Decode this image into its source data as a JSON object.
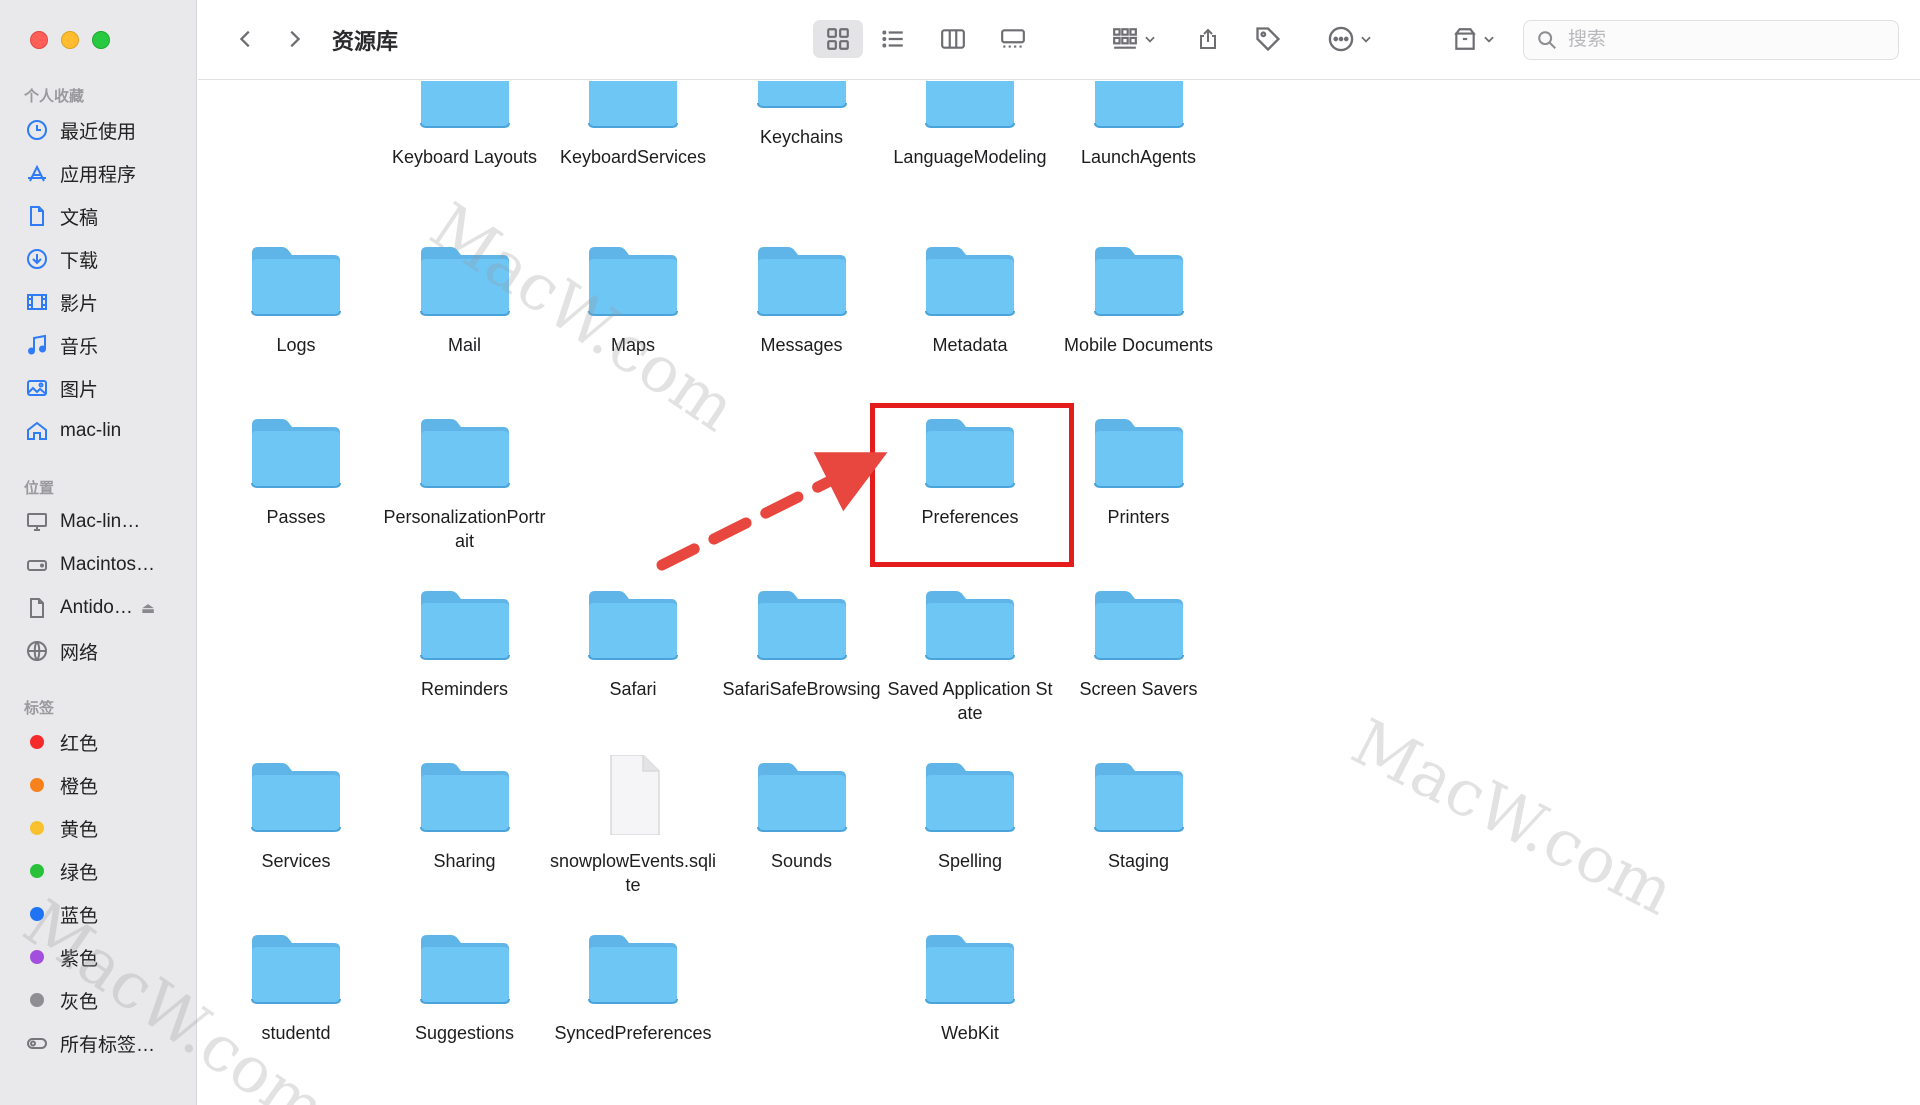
{
  "window": {
    "title": "资源库"
  },
  "sidebar": {
    "sections": {
      "favorites": "个人收藏",
      "locations": "位置",
      "tags": "标签"
    },
    "favorites": [
      {
        "label": "最近使用",
        "icon": "clock-icon"
      },
      {
        "label": "应用程序",
        "icon": "apps-icon"
      },
      {
        "label": "文稿",
        "icon": "document-icon"
      },
      {
        "label": "下载",
        "icon": "download-icon"
      },
      {
        "label": "影片",
        "icon": "film-icon"
      },
      {
        "label": "音乐",
        "icon": "music-icon"
      },
      {
        "label": "图片",
        "icon": "photo-icon"
      },
      {
        "label": "mac-lin",
        "icon": "home-icon"
      }
    ],
    "locations": [
      {
        "label": "Mac-lin…",
        "icon": "computer-icon"
      },
      {
        "label": "Macintos…",
        "icon": "disk-icon"
      },
      {
        "label": "Antido…",
        "icon": "file-icon"
      },
      {
        "label": "网络",
        "icon": "globe-icon"
      }
    ],
    "tags": [
      {
        "label": "红色",
        "color": "#f52b2b"
      },
      {
        "label": "橙色",
        "color": "#f7821b"
      },
      {
        "label": "黄色",
        "color": "#f9c12e"
      },
      {
        "label": "绿色",
        "color": "#29c13a"
      },
      {
        "label": "蓝色",
        "color": "#1f74f5"
      },
      {
        "label": "紫色",
        "color": "#a34fdd"
      },
      {
        "label": "灰色",
        "color": "#8e8e93"
      },
      {
        "label": "所有标签…",
        "color": ""
      }
    ]
  },
  "toolbar": {
    "search_placeholder": "搜索"
  },
  "files": [
    {
      "name": "Keyboard Layouts",
      "type": "folder"
    },
    {
      "name": "KeyboardServices",
      "type": "folder"
    },
    {
      "name": "Keychains",
      "type": "folder"
    },
    {
      "name": "LanguageModeling",
      "type": "folder"
    },
    {
      "name": "LaunchAgents",
      "type": "folder"
    },
    {
      "name": "Logs",
      "type": "folder"
    },
    {
      "name": "Mail",
      "type": "folder"
    },
    {
      "name": "Maps",
      "type": "folder"
    },
    {
      "name": "Messages",
      "type": "folder"
    },
    {
      "name": "Metadata",
      "type": "folder"
    },
    {
      "name": "Mobile Documents",
      "type": "folder"
    },
    {
      "name": "Passes",
      "type": "folder"
    },
    {
      "name": "PersonalizationPortrait",
      "type": "folder"
    },
    {
      "name": "Preferences",
      "type": "folder"
    },
    {
      "name": "Printers",
      "type": "folder"
    },
    {
      "name": "Reminders",
      "type": "folder"
    },
    {
      "name": "Safari",
      "type": "folder"
    },
    {
      "name": "SafariSafeBrowsing",
      "type": "folder"
    },
    {
      "name": "Saved Application State",
      "type": "folder"
    },
    {
      "name": "Screen Savers",
      "type": "folder"
    },
    {
      "name": "Services",
      "type": "folder"
    },
    {
      "name": "Sharing",
      "type": "folder"
    },
    {
      "name": "snowplowEvents.sqlite",
      "type": "file"
    },
    {
      "name": "Sounds",
      "type": "folder"
    },
    {
      "name": "Spelling",
      "type": "folder"
    },
    {
      "name": "Staging",
      "type": "folder"
    },
    {
      "name": "studentd",
      "type": "folder"
    },
    {
      "name": "Suggestions",
      "type": "folder"
    },
    {
      "name": "SyncedPreferences",
      "type": "folder"
    },
    {
      "name": "WebKit",
      "type": "folder"
    }
  ],
  "watermark": "MacW.com",
  "colors": {
    "folder": "#6ec6f5",
    "folder_tab": "#5fb4e8",
    "highlight": "#e51c1c",
    "arrow": "#e8473f"
  }
}
